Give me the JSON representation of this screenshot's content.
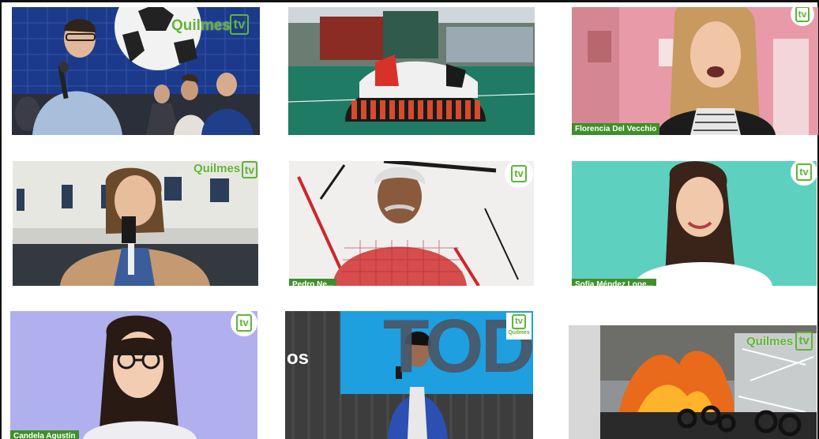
{
  "brand": {
    "name": "Quilmes",
    "tv": "tv",
    "color": "#5fb536"
  },
  "tiles": [
    {
      "id": "speaker-at-event",
      "name_tag": ""
    },
    {
      "id": "hockey-team-huddle",
      "name_tag": ""
    },
    {
      "id": "florencia-del-vecchio",
      "name_tag": "Florencia Del Vecchio"
    },
    {
      "id": "reporter-outdoors",
      "name_tag": ""
    },
    {
      "id": "pedro-interview",
      "name_tag": "Pedro Ne..."
    },
    {
      "id": "sofia-mendez",
      "name_tag": "Sofía Méndez Lope..."
    },
    {
      "id": "candela-agustin",
      "name_tag": "Candela Agustín"
    },
    {
      "id": "speaker-on-stage",
      "name_tag": "",
      "backdrop_text": "TOD",
      "side_text": "os"
    },
    {
      "id": "fire-scene",
      "name_tag": ""
    }
  ],
  "colors": {
    "name_tag_bg": "#3f8f2a",
    "wall_teal": "#5ed0c0",
    "wall_pink": "#e89aa8",
    "wall_lavender": "#b0b0ee",
    "stage_blue": "#1e9fe0"
  }
}
